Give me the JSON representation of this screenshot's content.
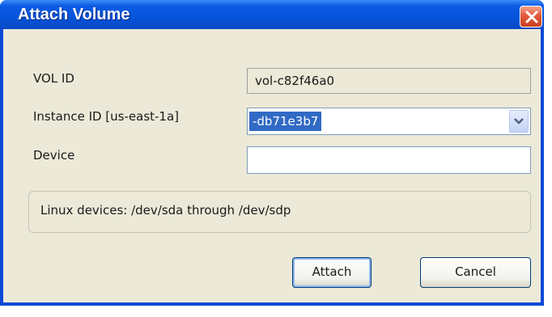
{
  "window": {
    "title": "Attach Volume"
  },
  "form": {
    "vol_id_label": "VOL ID",
    "vol_id_value": "vol-c82f46a0",
    "instance_label": "Instance ID [us-east-1a]",
    "instance_value": "-db71e3b7",
    "device_label": "Device",
    "device_value": ""
  },
  "info": {
    "text": "Linux devices: /dev/sda through /dev/sdp"
  },
  "buttons": {
    "attach": "Attach",
    "cancel": "Cancel"
  },
  "icons": {
    "close": "close-icon",
    "dropdown": "chevron-down-icon"
  }
}
